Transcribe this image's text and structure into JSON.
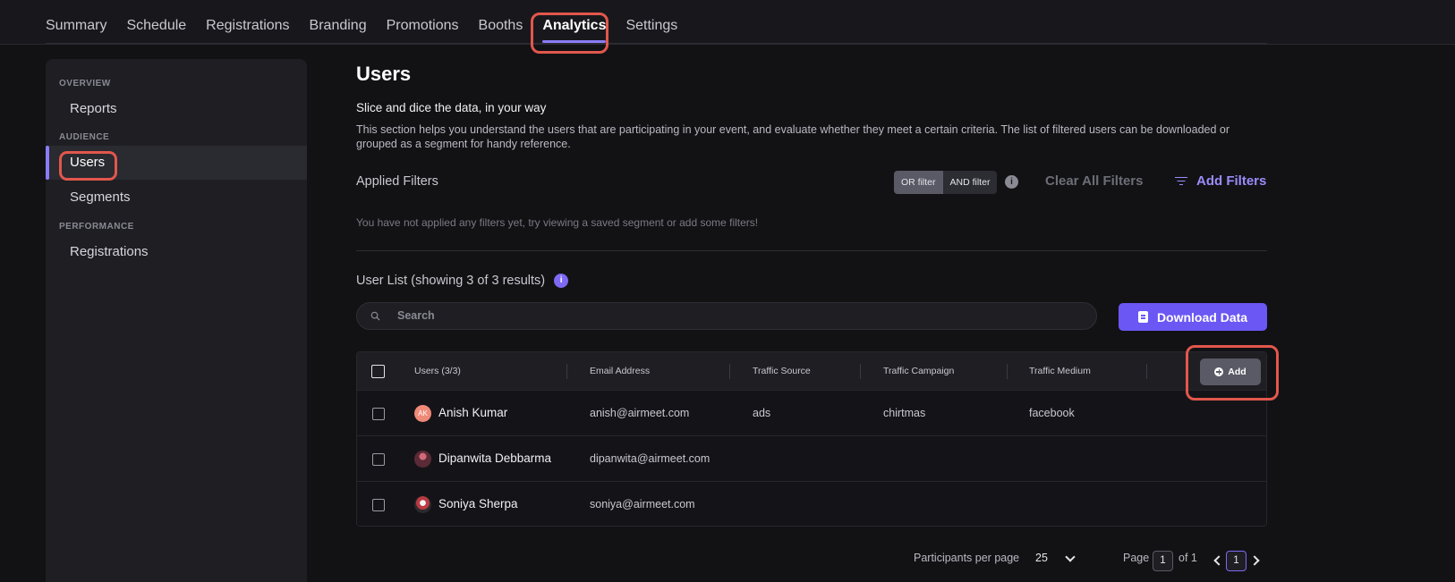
{
  "topnav": {
    "tabs": [
      "Summary",
      "Schedule",
      "Registrations",
      "Branding",
      "Promotions",
      "Booths",
      "Analytics",
      "Settings"
    ],
    "active": "Analytics"
  },
  "sidebar": {
    "sections": [
      {
        "title": "OVERVIEW",
        "items": [
          "Reports"
        ]
      },
      {
        "title": "AUDIENCE",
        "items": [
          "Users",
          "Segments"
        ]
      },
      {
        "title": "PERFORMANCE",
        "items": [
          "Registrations"
        ]
      }
    ],
    "active": "Users"
  },
  "main": {
    "title": "Users",
    "subtitle": "Slice and dice the data, in your way",
    "description": "This section helps you understand the users that are participating in your event, and evaluate whether they meet a certain criteria. The list of filtered users can be downloaded or grouped as a segment for handy reference.",
    "filters": {
      "label": "Applied Filters",
      "or_label": "OR filter",
      "and_label": "AND filter",
      "info": "i",
      "clear_label": "Clear All Filters",
      "add_label": "Add Filters",
      "empty_message": "You have not applied any filters yet, try viewing a saved segment or add some filters!"
    },
    "list": {
      "title": "User List (showing 3 of 3 results)",
      "info": "i",
      "search_placeholder": "Search",
      "download_label": "Download Data"
    },
    "table": {
      "columns": [
        "Users (3/3)",
        "Email Address",
        "Traffic Source",
        "Traffic Campaign",
        "Traffic Medium"
      ],
      "add_label": "Add",
      "rows": [
        {
          "initials": "AK",
          "name": "Anish Kumar",
          "email": "anish@airmeet.com",
          "source": "ads",
          "campaign": "chirtmas",
          "medium": "facebook"
        },
        {
          "initials": "",
          "name": "Dipanwita Debbarma",
          "email": "dipanwita@airmeet.com",
          "source": "",
          "campaign": "",
          "medium": ""
        },
        {
          "initials": "",
          "name": "Soniya Sherpa",
          "email": "soniya@airmeet.com",
          "source": "",
          "campaign": "",
          "medium": ""
        }
      ]
    },
    "pagination": {
      "per_page_label": "Participants per page",
      "per_page_value": "25",
      "page_label": "Page",
      "page_input": "1",
      "of_label": "of 1",
      "current_page": "1"
    }
  },
  "colors": {
    "accent": "#6b57f3",
    "highlight": "#e2574c",
    "background": "#121215"
  }
}
